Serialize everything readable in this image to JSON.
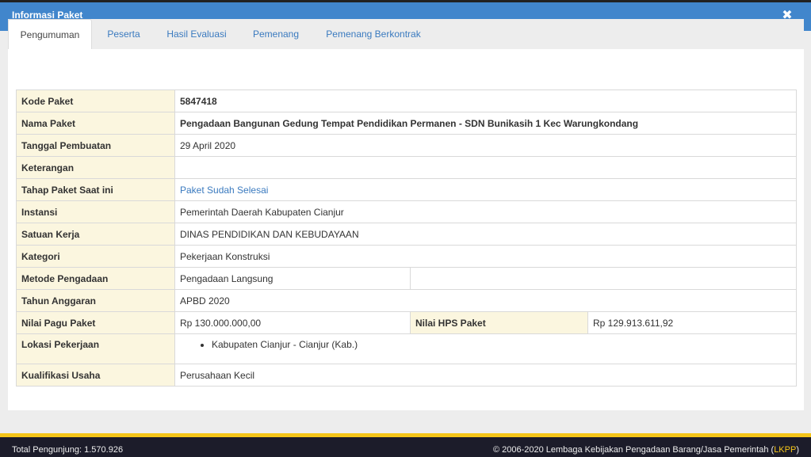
{
  "modal": {
    "title": "Informasi Paket",
    "close_icon": "close-icon"
  },
  "tabs": [
    {
      "label": "Pengumuman",
      "active": true
    },
    {
      "label": "Peserta",
      "active": false
    },
    {
      "label": "Hasil Evaluasi",
      "active": false
    },
    {
      "label": "Pemenang",
      "active": false
    },
    {
      "label": "Pemenang Berkontrak",
      "active": false
    }
  ],
  "info": {
    "kode_paket": {
      "label": "Kode Paket",
      "value": "5847418"
    },
    "nama_paket": {
      "label": "Nama Paket",
      "value": "Pengadaan Bangunan Gedung Tempat Pendidikan Permanen - SDN Bunikasih 1 Kec Warungkondang"
    },
    "tanggal_pembuatan": {
      "label": "Tanggal Pembuatan",
      "value": "29 April 2020"
    },
    "keterangan": {
      "label": "Keterangan",
      "value": ""
    },
    "tahap_paket": {
      "label": "Tahap Paket Saat ini",
      "value": "Paket Sudah Selesai"
    },
    "instansi": {
      "label": "Instansi",
      "value": "Pemerintah Daerah Kabupaten Cianjur"
    },
    "satuan_kerja": {
      "label": "Satuan Kerja",
      "value": "DINAS PENDIDIKAN DAN KEBUDAYAAN"
    },
    "kategori": {
      "label": "Kategori",
      "value": "Pekerjaan Konstruksi"
    },
    "metode_pengadaan": {
      "label": "Metode Pengadaan",
      "value": "Pengadaan Langsung"
    },
    "tahun_anggaran": {
      "label": "Tahun Anggaran",
      "value": "APBD 2020"
    },
    "nilai_pagu": {
      "label": "Nilai Pagu Paket",
      "value": "Rp 130.000.000,00"
    },
    "nilai_hps": {
      "label": "Nilai HPS Paket",
      "value": "Rp 129.913.611,92"
    },
    "lokasi_pekerjaan": {
      "label": "Lokasi Pekerjaan",
      "items": [
        "Kabupaten Cianjur - Cianjur (Kab.)"
      ]
    },
    "kualifikasi_usaha": {
      "label": "Kualifikasi Usaha",
      "value": "Perusahaan Kecil"
    }
  },
  "footer": {
    "visitors": "Total Pengunjung: 1.570.926",
    "copyright": "© 2006-2020 Lembaga Kebijakan Pengadaan Barang/Jasa Pemerintah (",
    "lkpp": "LKPP",
    "copyright_end": ")"
  },
  "colors": {
    "header_bg": "#4186cc",
    "label_bg": "#fbf6df",
    "link": "#3a7abf",
    "footer_accent": "#f5c518"
  }
}
